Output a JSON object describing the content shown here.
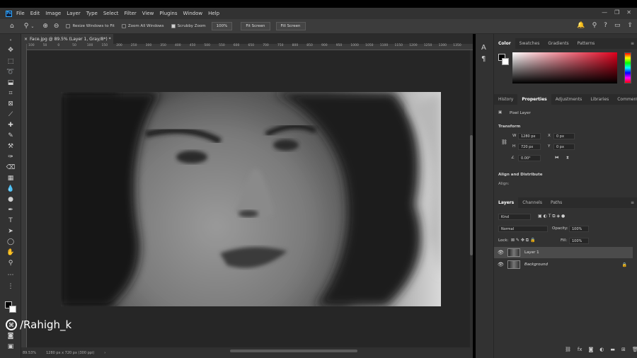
{
  "menubar": {
    "logo": "Ps",
    "items": [
      "File",
      "Edit",
      "Image",
      "Layer",
      "Type",
      "Select",
      "Filter",
      "View",
      "Plugins",
      "Window",
      "Help"
    ]
  },
  "options": {
    "resize_windows": "Resize Windows to Fit",
    "zoom_all": "Zoom All Windows",
    "scrubby_zoom": "Scrubby Zoom",
    "zoom_value": "100%",
    "fit_screen": "Fit Screen",
    "fill_screen": "Fill Screen"
  },
  "document": {
    "tab_title": "Face.jpg @ 89.5% (Layer 1, Gray/8*) *",
    "close": "×"
  },
  "ruler_ticks": [
    "100",
    "50",
    "0",
    "50",
    "100",
    "150",
    "200",
    "250",
    "300",
    "350",
    "400",
    "450",
    "500",
    "550",
    "600",
    "650",
    "700",
    "750",
    "800",
    "850",
    "900",
    "950",
    "1000",
    "1050",
    "1100",
    "1150",
    "1200",
    "1250",
    "1300",
    "1350"
  ],
  "status": {
    "zoom": "89.53%",
    "size": "1280 px x 720 px (300 ppi)",
    "arrow": "›"
  },
  "watermark": {
    "icon": "⌘",
    "text": "/Rahigh_k"
  },
  "panels": {
    "color_tabs": [
      "Color",
      "Swatches",
      "Gradients",
      "Patterns"
    ],
    "mid_tabs": [
      "History",
      "Properties",
      "Adjustments",
      "Libraries",
      "Comments"
    ],
    "properties": {
      "layer_kind": "Pixel Layer",
      "transform_label": "Transform",
      "w_label": "W",
      "w_value": "1280 px",
      "h_label": "H",
      "h_value": "720 px",
      "x_label": "X",
      "x_value": "0 px",
      "y_label": "Y",
      "y_value": "0 px",
      "angle_value": "0.00°",
      "align_label": "Align and Distribute",
      "align_sub": "Align:"
    },
    "layer_tabs": [
      "Layers",
      "Channels",
      "Paths"
    ],
    "layers": {
      "filter_kind": "Kind",
      "blend_mode": "Normal",
      "opacity_label": "Opacity:",
      "opacity_value": "100%",
      "lock_label": "Lock:",
      "fill_label": "Fill:",
      "fill_value": "100%",
      "items": [
        {
          "name": "Layer 1",
          "selected": true
        },
        {
          "name": "Background",
          "selected": false
        }
      ]
    }
  }
}
